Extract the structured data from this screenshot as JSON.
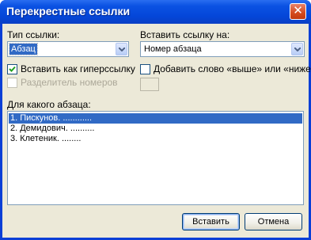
{
  "window": {
    "title": "Перекрестные ссылки",
    "close_glyph": "✕"
  },
  "reference_type": {
    "label": "Тип ссылки:",
    "value": "Абзац"
  },
  "insert_reference_to": {
    "label": "Вставить ссылку на:",
    "value": "Номер абзаца"
  },
  "checkboxes": {
    "insert_as_hyperlink": {
      "label": "Вставить как гиперссылку",
      "checked": true,
      "enabled": true
    },
    "include_above_below": {
      "label": "Добавить слово «выше» или «ниже»",
      "checked": false,
      "enabled": true
    },
    "separate_numbers": {
      "label": "Разделитель номеров",
      "checked": false,
      "enabled": false
    }
  },
  "separator_field": {
    "value": ""
  },
  "list": {
    "label": "Для какого абзаца:",
    "items": [
      {
        "text": "1. Пискунов. ............",
        "selected": true
      },
      {
        "text": "2. Демидович. ..........",
        "selected": false
      },
      {
        "text": "3. Клетеник. ........",
        "selected": false
      }
    ]
  },
  "buttons": {
    "insert": "Вставить",
    "cancel": "Отмена"
  },
  "colors": {
    "titlebar": "#0b52e3",
    "client_bg": "#ece9d8",
    "selection": "#316ac5",
    "close_button": "#d44a1e"
  },
  "icons": {
    "close": "close-icon",
    "dropdown": "chevron-down-icon",
    "check": "checkmark-icon"
  }
}
